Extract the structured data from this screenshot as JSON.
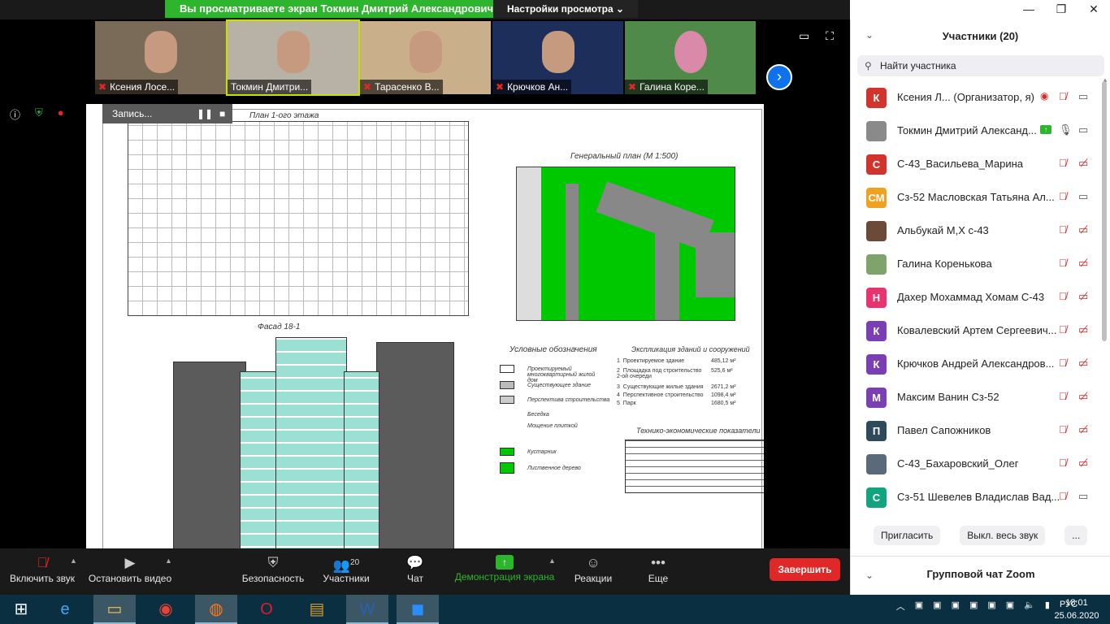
{
  "top": {
    "share_banner": "Вы просматриваете экран Токмин Дмитрий Александрович С...",
    "view_settings": "Настройки просмотра ⌄",
    "window_controls": [
      "—",
      "❐",
      "✕"
    ]
  },
  "thumbs": [
    {
      "name": "Ксения Лосе..."
    },
    {
      "name": "Токмин Дмитри..."
    },
    {
      "name": "Тарасенко В..."
    },
    {
      "name": "Крючков Ан..."
    },
    {
      "name": "Галина Коре..."
    }
  ],
  "recording": {
    "label": "Запись...",
    "pause": "❚❚",
    "stop": "■"
  },
  "drawing": {
    "plan_title": "План 1-ого этажа",
    "genplan_title": "Генеральный план (М 1:500)",
    "facade_title": "Фасад 18-1",
    "legend_title": "Условные обозначения",
    "legend_items": [
      "Проектируемый многоквартирный жилой дом",
      "Существующее здание",
      "Перспектива строительства",
      "Беседка",
      "Мощение плиткой",
      "Кустарник",
      "Лиственное дерево"
    ],
    "explication_title": "Экспликация зданий и сооружений",
    "explication": [
      {
        "no": "1",
        "name": "Проектируемое здание",
        "value": "485,12 м²"
      },
      {
        "no": "2",
        "name": "Площадка под строительство 2-ой очереди",
        "value": "525,6 м²"
      },
      {
        "no": "3",
        "name": "Существующие жилые здания",
        "value": "2671,2 м²"
      },
      {
        "no": "4",
        "name": "Перспективное строительство",
        "value": "1098,4 м²"
      },
      {
        "no": "5",
        "name": "Парк",
        "value": "1680,5 м²"
      }
    ],
    "tep_title": "Технико-экономические показатели"
  },
  "panel": {
    "title": "Участники (20)",
    "search_placeholder": "Найти участника",
    "participants": [
      {
        "initials": "К",
        "color": "#d0342c",
        "name": "Ксения Л...  (Организатор, я)",
        "mic": "off",
        "cam": "on",
        "rec": true
      },
      {
        "initials": "",
        "color": "#8a8a8a",
        "name": "Токмин Дмитрий Александ...",
        "mic": "on",
        "cam": "on",
        "share": true
      },
      {
        "initials": "С",
        "color": "#d0342c",
        "name": "С-43_Васильева_Марина",
        "mic": "off",
        "cam": "off"
      },
      {
        "initials": "СМ",
        "color": "#f0a11f",
        "name": "Сз-52 Масловская Татьяна Ал...",
        "mic": "off",
        "cam": "on"
      },
      {
        "initials": "",
        "color": "#6b4a3a",
        "name": "Альбукай М,Х с-43",
        "mic": "off",
        "cam": "off"
      },
      {
        "initials": "",
        "color": "#7fa36a",
        "name": "Галина Коренькова",
        "mic": "off",
        "cam": "off"
      },
      {
        "initials": "Н",
        "color": "#e8346e",
        "name": "Дахер Мохаммад Хомам С-43",
        "mic": "off",
        "cam": "off"
      },
      {
        "initials": "К",
        "color": "#7a3fb3",
        "name": "Ковалевский Артем Сергеевич...",
        "mic": "off",
        "cam": "off"
      },
      {
        "initials": "К",
        "color": "#7a3fb3",
        "name": "Крючков Андрей Александров...",
        "mic": "off",
        "cam": "off"
      },
      {
        "initials": "М",
        "color": "#7a3fb3",
        "name": "Максим Ванин Сз-52",
        "mic": "off",
        "cam": "off"
      },
      {
        "initials": "П",
        "color": "#2f4a5a",
        "name": "Павел Сапожников",
        "mic": "off",
        "cam": "off"
      },
      {
        "initials": "",
        "color": "#5a6a7a",
        "name": "С-43_Бахаровский_Олег",
        "mic": "off",
        "cam": "off"
      },
      {
        "initials": "С",
        "color": "#12a37f",
        "name": "Сз-51 Шевелев Владислав Вад...",
        "mic": "off",
        "cam": "on"
      }
    ],
    "buttons": {
      "invite": "Пригласить",
      "mute_all": "Выкл. весь звук",
      "more": "..."
    },
    "chat_title": "Групповой чат Zoom"
  },
  "toolbar": {
    "mute": "Включить звук",
    "video": "Остановить видео",
    "security": "Безопасность",
    "participants": "Участники",
    "participants_count": "20",
    "chat": "Чат",
    "share": "Демонстрация экрана",
    "reactions": "Реакции",
    "more": "Еще",
    "end": "Завершить"
  },
  "taskbar": {
    "lang": "РУС",
    "time": "18:01",
    "date": "25.06.2020"
  }
}
